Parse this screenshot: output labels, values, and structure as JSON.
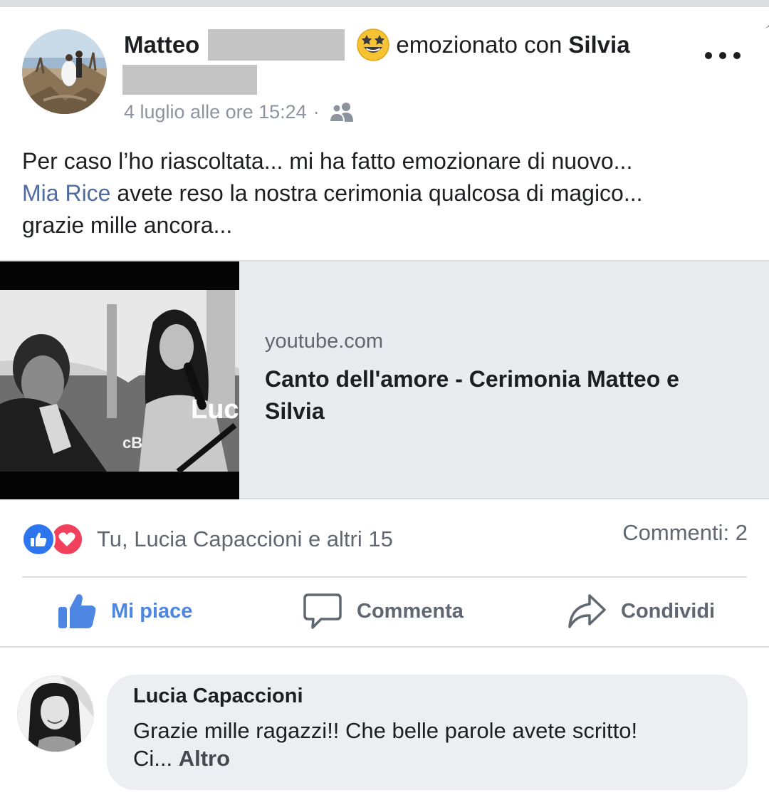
{
  "post": {
    "author_first_name": "Matteo",
    "feeling_text": "emozionato con",
    "with_name": "Silvia",
    "timestamp": "4 luglio alle ore 15:24",
    "separator": "·",
    "audience_icon": "friends-icon",
    "feeling_icon": "star-struck-emoji-icon",
    "more_icon": "more-options-icon",
    "text_line1": "Per caso l’ho riascoltata... mi ha fatto emozionare di nuovo...",
    "mention": "Mia Rice",
    "text_line2_rest": " avete reso la nostra cerimonia qualcosa di magico...",
    "text_line3": "grazie mille ancora..."
  },
  "link_preview": {
    "domain": "youtube.com",
    "title": "Canto dell'amore - Cerimonia Matteo e Silvia",
    "thumbnail_overlay": "Luc",
    "thumbnail_logo": "cB"
  },
  "reactions": {
    "icons": [
      "like-reaction-icon",
      "love-reaction-icon"
    ],
    "summary": "Tu, Lucia Capaccioni e altri 15",
    "comments_count": "Commenti: 2"
  },
  "actions": {
    "like": "Mi piace",
    "comment": "Commenta",
    "share": "Condividi"
  },
  "comment": {
    "author": "Lucia Capaccioni",
    "text_line1": "Grazie mille ragazzi!! Che belle parole avete scritto!",
    "text_line2": "Ci... ",
    "more": "Altro"
  },
  "colors": {
    "accent_blue": "#4d86e3",
    "like_blue": "#2e75f0",
    "love_red": "#f0405c",
    "mention_blue": "#4f6ba0",
    "muted_gray": "#606770",
    "preview_bg": "#e9ebee"
  }
}
